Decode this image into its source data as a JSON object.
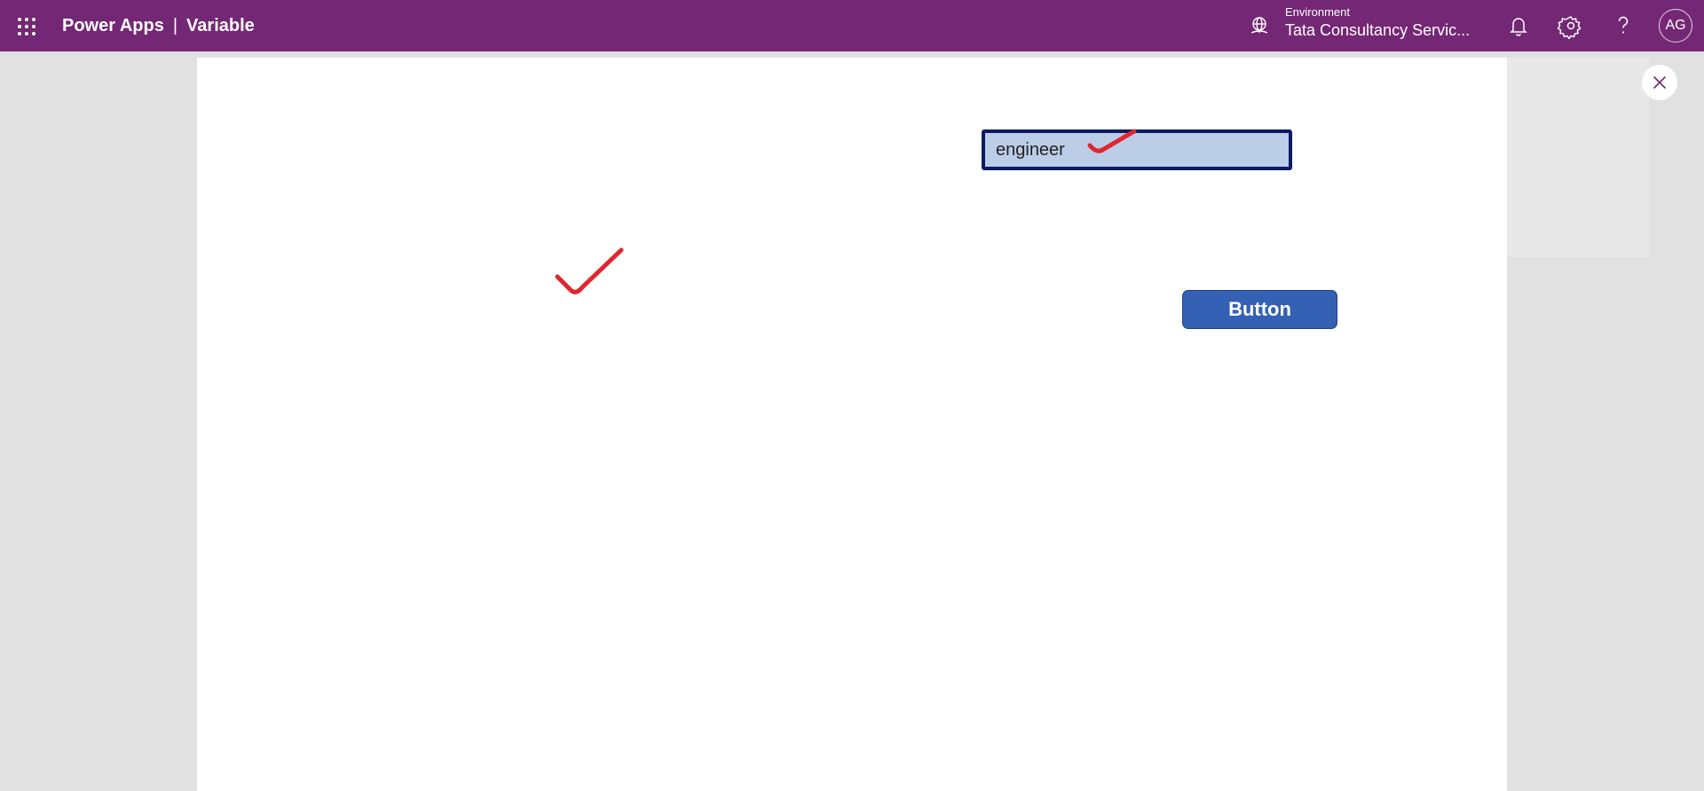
{
  "header": {
    "app_name": "Power Apps",
    "separator": "|",
    "app_title": "Variable",
    "environment_label": "Environment",
    "environment_name": "Tata Consultancy Servic...",
    "avatar_initials": "AG",
    "icons": {
      "waffle": "app-launcher-icon",
      "environment": "environment-globe-icon",
      "notifications": "bell-icon",
      "settings": "gear-icon",
      "help": "help-icon"
    }
  },
  "canvas": {
    "text_input_value": "engineer",
    "button_label": "Button",
    "close_icon": "close-icon",
    "annotation": "red-checkmark"
  },
  "colors": {
    "header_bg": "#742774",
    "workspace_bg": "#e1e1e1",
    "canvas_bg": "#ffffff",
    "input_border": "#0b1a63",
    "input_fill": "#bccde8",
    "button_fill": "#3561b4",
    "checkmark": "#e0262e"
  }
}
